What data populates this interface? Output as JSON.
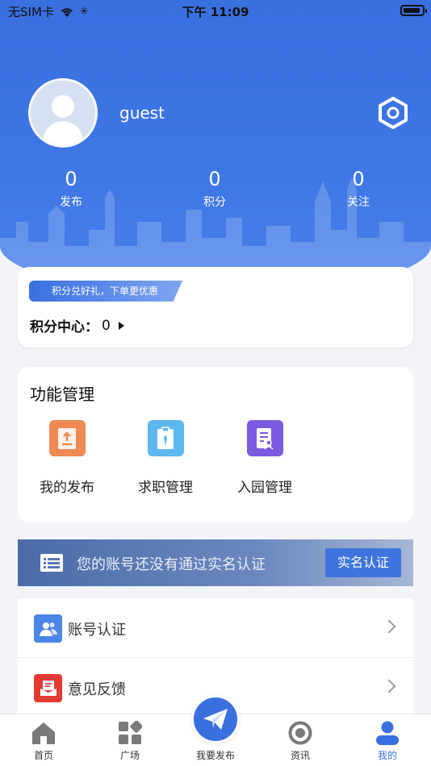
{
  "status_bar": {
    "carrier": "无SIM卡",
    "time": "下午 11:09"
  },
  "profile": {
    "username": "guest"
  },
  "stats": [
    {
      "value": "0",
      "label": "发布"
    },
    {
      "value": "0",
      "label": "积分"
    },
    {
      "value": "0",
      "label": "关注"
    }
  ],
  "points_card": {
    "promo": "积分兑好礼，下单更优惠",
    "center_label": "积分中心：",
    "center_value": "0"
  },
  "functions": {
    "title": "功能管理",
    "items": [
      {
        "label": "我的发布",
        "icon": "upload-doc-icon",
        "color": "#ef8a55"
      },
      {
        "label": "求职管理",
        "icon": "id-badge-icon",
        "color": "#5cb8ef"
      },
      {
        "label": "入园管理",
        "icon": "document-user-icon",
        "color": "#7a5be0"
      }
    ]
  },
  "verify_banner": {
    "text": "您的账号还没有通过实名认证",
    "button": "实名认证"
  },
  "list": [
    {
      "label": "账号认证",
      "icon": "users-icon",
      "color": "#4a86e8"
    },
    {
      "label": "意见反馈",
      "icon": "mail-feedback-icon",
      "color": "#e33b32"
    }
  ],
  "tabbar": {
    "home": "首页",
    "square": "广场",
    "publish": "我要发布",
    "news": "资讯",
    "mine": "我的"
  },
  "colors": {
    "primary": "#3a6fe0",
    "background": "#f3f4f7"
  }
}
